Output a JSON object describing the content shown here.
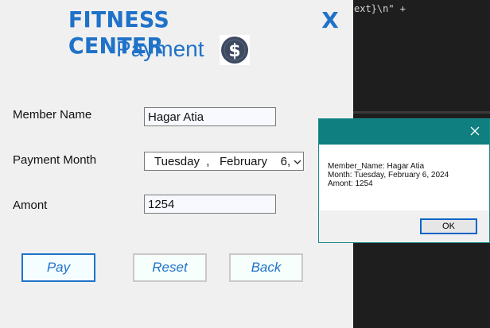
{
  "editor": {
    "code_snippet": "ext}\\n\" +"
  },
  "app": {
    "title": "Fitness Center",
    "close_label": "X",
    "subtitle": "Payment",
    "coin_icon": "dollar-coin-icon"
  },
  "form": {
    "member_label": "Member Name",
    "member_value": "Hagar Atia",
    "month_label": "Payment  Month",
    "month_value": "Tuesday  ,   February    6, ",
    "amount_label": "Amont",
    "amount_value": "1254"
  },
  "buttons": {
    "pay": "Pay",
    "reset": "Reset",
    "back": "Back"
  },
  "dialog": {
    "line1": "Member_Name: Hagar Atia",
    "line2": "Month: Tuesday, February 6, 2024",
    "line3": "Amont: 1254",
    "ok": "OK"
  },
  "colors": {
    "accent": "#1f72c8",
    "dialog_titlebar": "#0f7f80",
    "editor_bg": "#1e1e1e"
  }
}
